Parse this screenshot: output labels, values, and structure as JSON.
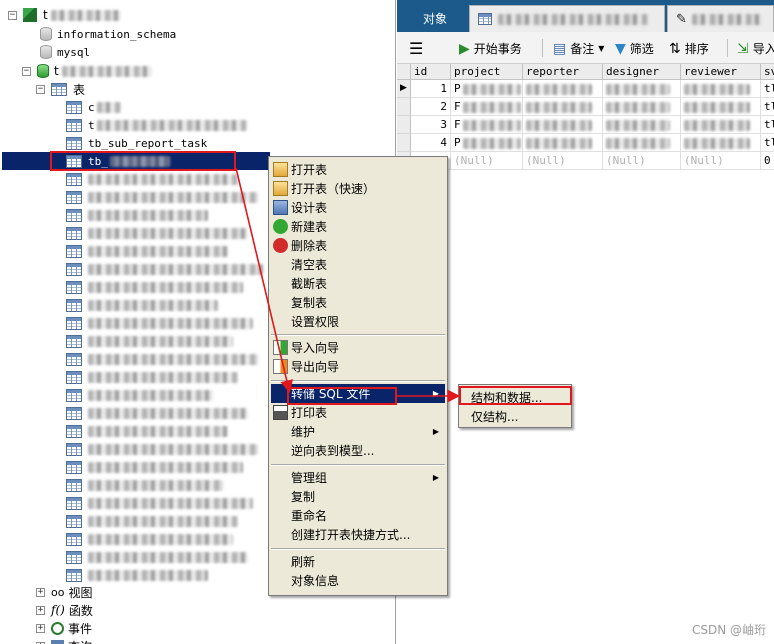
{
  "tree": {
    "connections": [
      {
        "label_visible": "t",
        "blurred": true
      },
      {
        "label": "information_schema"
      },
      {
        "label": "mysql"
      },
      {
        "label_visible": "t",
        "blurred": true
      }
    ],
    "tables_folder": "表",
    "visible_tables": {
      "row1": "c",
      "row2": "t",
      "row3": "tb_sub_report_task",
      "selected": "tb_"
    },
    "bottom_folders": [
      {
        "label": "视图",
        "icon": "glasses-icon"
      },
      {
        "label": "函数",
        "icon": "function-icon"
      },
      {
        "label": "事件",
        "icon": "clock-icon"
      },
      {
        "label": "查询",
        "icon": "query-icon"
      }
    ]
  },
  "tabs": {
    "objects": "对象"
  },
  "toolbar": {
    "begin_transaction": "开始事务",
    "note": "备注",
    "filter": "筛选",
    "sort": "排序",
    "import": "导入"
  },
  "grid": {
    "columns": [
      "id",
      "project",
      "reporter",
      "designer",
      "reviewer",
      "sv"
    ],
    "ids": [
      "1",
      "2",
      "3",
      "4"
    ],
    "project_prefix": [
      "P",
      "F",
      "F",
      "P"
    ],
    "sv_prefix": [
      "tl",
      "tl",
      "tl",
      "tl"
    ],
    "null_text": "(Null)",
    "last_sv": "0"
  },
  "context_menu": {
    "items": [
      "打开表",
      "打开表（快速）",
      "设计表",
      "新建表",
      "删除表",
      "清空表",
      "截断表",
      "复制表",
      "设置权限",
      "导入向导",
      "导出向导",
      "转储 SQL 文件",
      "打印表",
      "维护",
      "逆向表到模型...",
      "管理组",
      "复制",
      "重命名",
      "创建打开表快捷方式...",
      "刷新",
      "对象信息"
    ]
  },
  "submenu": {
    "items": [
      "结构和数据...",
      "仅结构..."
    ]
  },
  "watermark": "CSDN @岫珩",
  "colors": {
    "selection": "#0a246a",
    "tab_bar": "#1c5a8c",
    "annotation_red": "#e0171c",
    "menu_bg": "#ece9d8"
  }
}
